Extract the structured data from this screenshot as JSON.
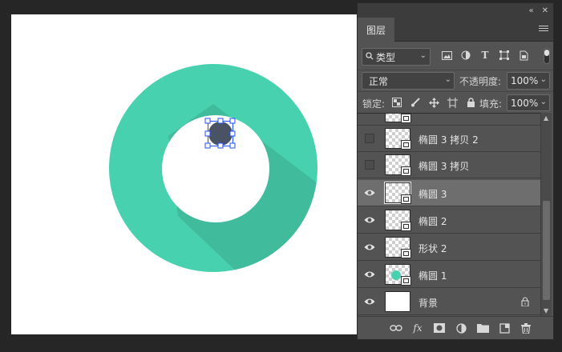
{
  "window": {
    "collapse_glyph": "«",
    "close_glyph": "✕"
  },
  "layers_panel": {
    "tab_label": "图层",
    "filter_kind": "类型",
    "blend_mode": "正常",
    "opacity_label": "不透明度:",
    "opacity_value": "100%",
    "lock_label": "锁定:",
    "fill_label": "填充:",
    "fill_value": "100%",
    "layers": [
      {
        "name": "椭圆 3 拷贝 2",
        "visible": false,
        "thumb": "transparent-shape",
        "selected": false
      },
      {
        "name": "椭圆 3 拷贝",
        "visible": false,
        "thumb": "transparent-shape",
        "selected": false
      },
      {
        "name": "椭圆 3",
        "visible": true,
        "thumb": "transparent-shape",
        "selected": true
      },
      {
        "name": "椭圆 2",
        "visible": true,
        "thumb": "transparent-shape",
        "selected": false
      },
      {
        "name": "形状 2",
        "visible": true,
        "thumb": "transparent-shape",
        "selected": false
      },
      {
        "name": "椭圆 1",
        "visible": true,
        "thumb": "teal-shape",
        "selected": false
      },
      {
        "name": "背景",
        "visible": true,
        "thumb": "white",
        "locked": true,
        "selected": false
      }
    ],
    "bottom_icons": [
      "link-icon",
      "fx-icon",
      "mask-icon",
      "adjustment-icon",
      "folder-icon",
      "new-layer-icon",
      "trash-icon"
    ]
  },
  "colors": {
    "ring": "#48d1ae",
    "ring_shadow": "#3aa98d",
    "small_dot": "#4a5364",
    "selection": "#1f4fff"
  }
}
